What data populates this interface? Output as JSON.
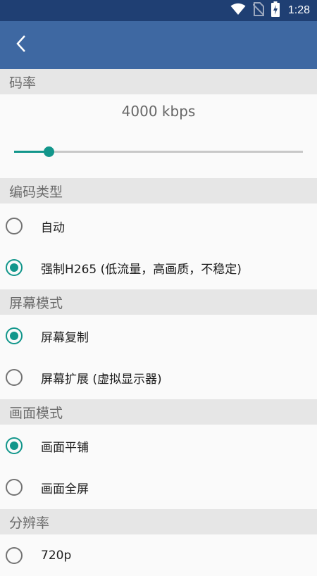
{
  "status_bar": {
    "time": "1:28",
    "icons": [
      "wifi-icon",
      "no-sim-icon",
      "battery-charging-icon"
    ]
  },
  "app_bar": {
    "back_icon": "back-arrow-icon"
  },
  "colors": {
    "status_bar": "#1f3f73",
    "app_bar": "#3e68a2",
    "accent": "#12968b",
    "section_header_bg": "#e6e6e6"
  },
  "bitrate": {
    "header": "码率",
    "value_label": "4000 kbps",
    "slider_fraction": 0.12
  },
  "encoding": {
    "header": "编码类型",
    "options": [
      {
        "label": "自动",
        "checked": false
      },
      {
        "label": "强制H265 (低流量，高画质，不稳定)",
        "checked": true
      }
    ]
  },
  "screen_mode": {
    "header": "屏幕模式",
    "options": [
      {
        "label": "屏幕复制",
        "checked": true
      },
      {
        "label": "屏幕扩展 (虚拟显示器)",
        "checked": false
      }
    ]
  },
  "picture_mode": {
    "header": "画面模式",
    "options": [
      {
        "label": "画面平铺",
        "checked": true
      },
      {
        "label": "画面全屏",
        "checked": false
      }
    ]
  },
  "resolution": {
    "header": "分辨率",
    "options": [
      {
        "label": "720p",
        "checked": false
      }
    ]
  }
}
